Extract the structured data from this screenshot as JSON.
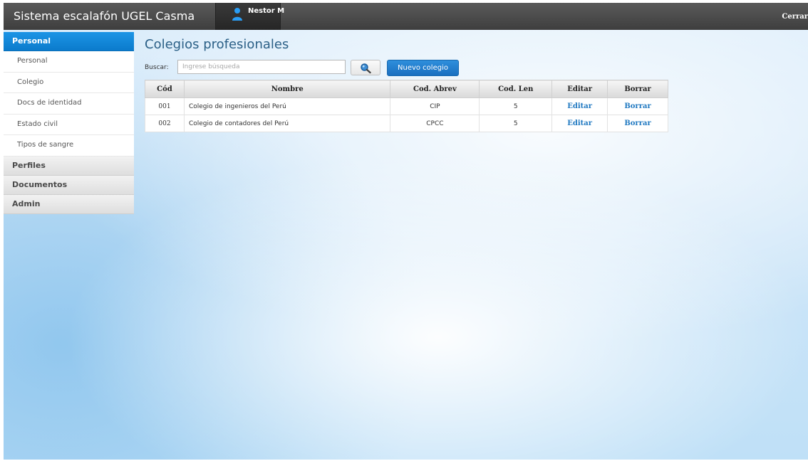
{
  "header": {
    "title": "Sistema escalafón UGEL Casma",
    "user_name": "Nestor M",
    "logout_label": "Cerrar"
  },
  "sidebar": {
    "sections": [
      {
        "label": "Personal",
        "active": true,
        "items": [
          {
            "label": "Personal"
          },
          {
            "label": "Colegio"
          },
          {
            "label": "Docs de identidad"
          },
          {
            "label": "Estado civil"
          },
          {
            "label": "Tipos de sangre"
          }
        ]
      },
      {
        "label": "Perfiles",
        "active": false
      },
      {
        "label": "Documentos",
        "active": false
      },
      {
        "label": "Admin",
        "active": false
      }
    ]
  },
  "main": {
    "page_title": "Colegios profesionales",
    "search": {
      "label": "Buscar:",
      "placeholder": "Ingrese búsqueda",
      "value": ""
    },
    "new_button_label": "Nuevo colegio",
    "table": {
      "columns": [
        "Cód",
        "Nombre",
        "Cod. Abrev",
        "Cod. Len",
        "Editar",
        "Borrar"
      ],
      "rows": [
        {
          "cod": "001",
          "nombre": "Colegio de ingenieros del Perú",
          "abrev": "CIP",
          "len": "5",
          "edit": "Editar",
          "delete": "Borrar"
        },
        {
          "cod": "002",
          "nombre": "Colegio de contadores del Perú",
          "abrev": "CPCC",
          "len": "5",
          "edit": "Editar",
          "delete": "Borrar"
        }
      ]
    }
  },
  "colors": {
    "topbar": "#474747",
    "active_section": "#0f84d6",
    "link": "#1f78c1",
    "title": "#2a5f86"
  },
  "icons": {
    "user": "user-icon",
    "search": "search-icon"
  }
}
